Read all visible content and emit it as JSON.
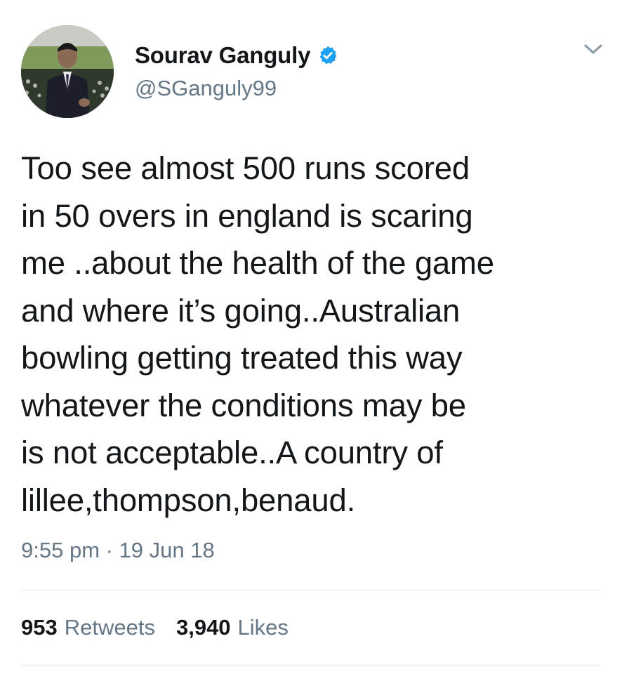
{
  "tweet": {
    "author": {
      "display_name": "Sourav Ganguly",
      "handle": "@SGanguly99",
      "verified": true
    },
    "text": "Too see almost 500 runs scored\nin 50 overs in england is scaring\nme ..about the health of the game\nand where it’s going..Australian\nbowling getting treated this way\nwhatever the conditions may be\nis not acceptable..A country of\nlillee,thompson,benaud.",
    "timestamp": "9:55 pm · 19 Jun 18",
    "stats": {
      "retweets_count": "953",
      "retweets_label": "Retweets",
      "likes_count": "3,940",
      "likes_label": "Likes"
    }
  },
  "icons": {
    "verified": "verified-badge-icon",
    "menu": "chevron-down-icon"
  },
  "colors": {
    "text_primary": "#14171a",
    "text_secondary": "#657786",
    "verified_blue": "#1da1f2",
    "divider": "#e1e8ed"
  }
}
